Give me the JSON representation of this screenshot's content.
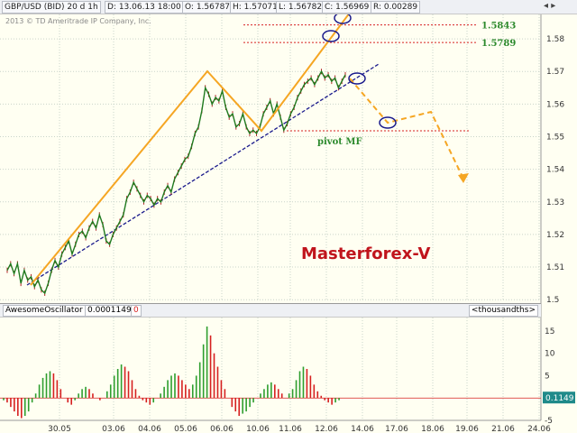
{
  "header": {
    "symbol": "GBP/USD (BID) 20 d 1h",
    "date": "D: 13.06.13 18:00",
    "open": "O: 1.56787",
    "high": "H: 1.57071",
    "low": "L: 1.56782",
    "close": "C: 1.56969",
    "range": "R: 0.00289",
    "copyright": "2013 © TD Ameritrade IP Company, Inc."
  },
  "chart_data": [
    {
      "type": "line",
      "subtype": "candlestick-style price line",
      "title": "",
      "ylim": [
        1.5,
        1.585
      ],
      "y_ticks": [
        "1.5",
        "1.51",
        "1.52",
        "1.53",
        "1.54",
        "1.55",
        "1.56",
        "1.57",
        "1.58"
      ],
      "x_ticks": [
        "30.05",
        "03.06",
        "04.06",
        "05.06",
        "06.06",
        "10.06",
        "11.06",
        "12.06",
        "14.06",
        "17.06",
        "18.06",
        "19.06",
        "21.06",
        "24.06"
      ],
      "series": [
        {
          "values": [
            1.509,
            1.511,
            1.508,
            1.511,
            1.505,
            1.509,
            1.506,
            1.507,
            1.504,
            1.506,
            1.503,
            1.502,
            1.505,
            1.509,
            1.512,
            1.51,
            1.514,
            1.516,
            1.518,
            1.514,
            1.517,
            1.52,
            1.521,
            1.519,
            1.522,
            1.524,
            1.522,
            1.526,
            1.523,
            1.518,
            1.517,
            1.52,
            1.522,
            1.524,
            1.526,
            1.531,
            1.533,
            1.536,
            1.534,
            1.532,
            1.53,
            1.532,
            1.531,
            1.529,
            1.531,
            1.53,
            1.533,
            1.535,
            1.533,
            1.537,
            1.539,
            1.541,
            1.543,
            1.544,
            1.547,
            1.551,
            1.553,
            1.558,
            1.565,
            1.563,
            1.56,
            1.562,
            1.561,
            1.564,
            1.559,
            1.556,
            1.557,
            1.553,
            1.554,
            1.557,
            1.553,
            1.551,
            1.552,
            1.551,
            1.553,
            1.557,
            1.559,
            1.561,
            1.557,
            1.56,
            1.556,
            1.552,
            1.554,
            1.557,
            1.559,
            1.562,
            1.564,
            1.566,
            1.567,
            1.568,
            1.566,
            1.568,
            1.57,
            1.568,
            1.569,
            1.567,
            1.568,
            1.565,
            1.567,
            1.569
          ]
        }
      ],
      "levels": [
        {
          "label": "1.5843",
          "value": 1.5843
        },
        {
          "label": "1.5789",
          "value": 1.5789
        },
        {
          "label": "pivot MF",
          "value": 1.5518
        }
      ],
      "watermark": "Masterforex-V",
      "colors": {
        "price": "#1f7a1f",
        "zigzag": "#f5a623",
        "trendline": "#1a1a8c",
        "level": "#d62020",
        "circle": "#1a1a8c"
      }
    },
    {
      "type": "bar",
      "title": "AwesomeOscillator",
      "value_tag": "0.0001149",
      "extra_tag": "0",
      "scale_label": "<thousandths>",
      "current_label": "0.1149",
      "ylim": [
        -5,
        15
      ],
      "y_ticks": [
        "15",
        "10",
        "5",
        "0",
        "-5"
      ],
      "values": [
        -0.5,
        -1,
        -2,
        -3,
        -4,
        -4.5,
        -4,
        -3,
        -1,
        1,
        3,
        4.5,
        5.5,
        6,
        5.5,
        4,
        2,
        0,
        -1,
        -1.5,
        -0.5,
        1,
        2,
        2.5,
        2,
        1,
        0,
        -0.5,
        0,
        1.5,
        3,
        5,
        6.5,
        7.5,
        7,
        6,
        4,
        2,
        0.5,
        -0.5,
        -1,
        -1.5,
        -1,
        0,
        1,
        2.5,
        4,
        5,
        5.5,
        5,
        4,
        3,
        2,
        3,
        5,
        8,
        12,
        16,
        14,
        10,
        7,
        4,
        2,
        0,
        -2,
        -3,
        -4,
        -3.5,
        -3,
        -2,
        -1,
        0,
        1,
        2,
        3,
        3.5,
        3,
        2,
        1,
        0,
        1,
        2,
        4,
        6,
        7,
        6.5,
        5,
        3,
        1.5,
        0.5,
        -0.5,
        -1,
        -1.5,
        -1,
        -0.5,
        0
      ],
      "colors": {
        "up": "#2e9e2e",
        "down": "#d62020"
      }
    }
  ]
}
